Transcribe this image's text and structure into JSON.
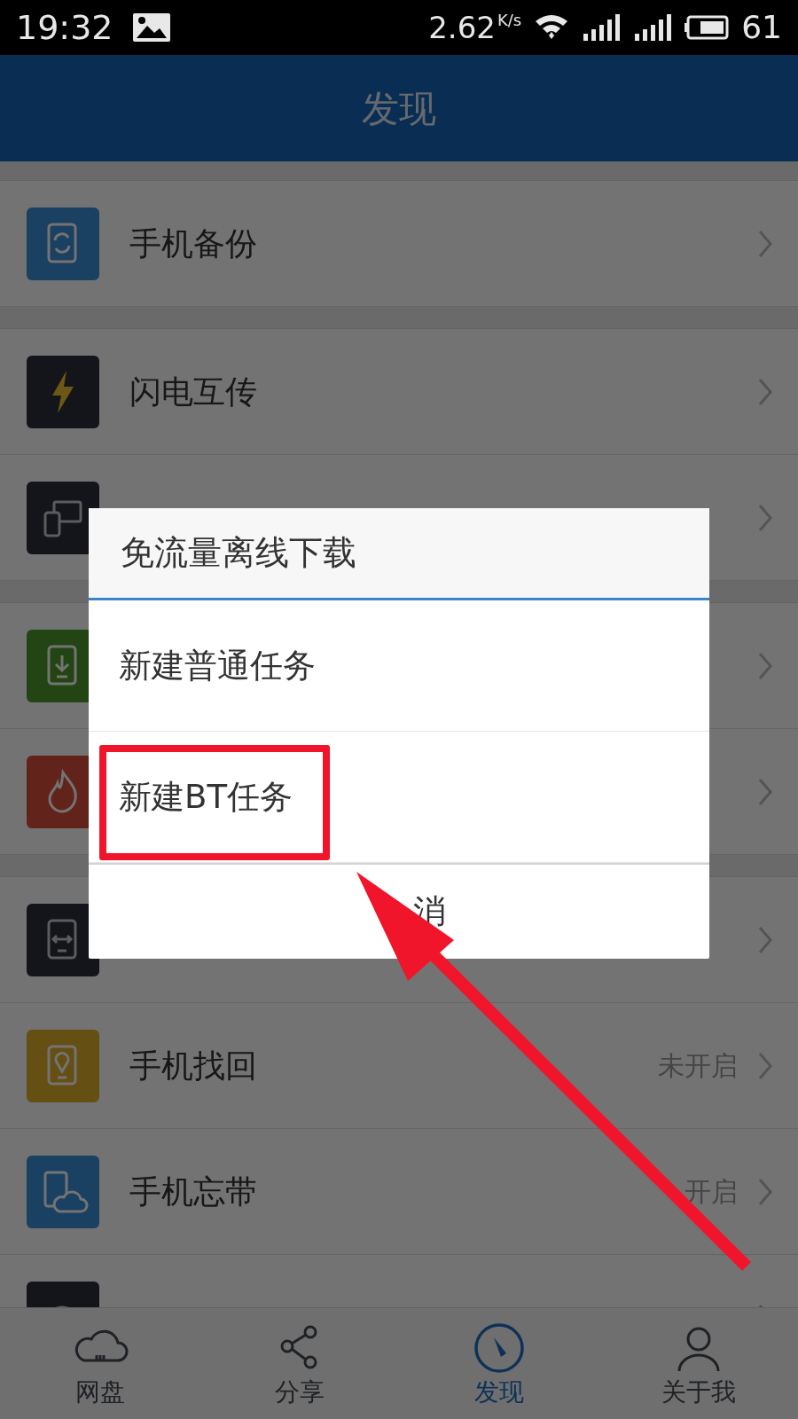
{
  "status_bar": {
    "time": "19:32",
    "speed": "2.62",
    "speed_unit": "K/s",
    "battery": "61"
  },
  "header": {
    "title": "发现"
  },
  "sections": [
    {
      "rows": [
        {
          "kind": "backup",
          "label": "手机备份"
        }
      ]
    },
    {
      "rows": [
        {
          "kind": "bolt",
          "label": "闪电互传"
        },
        {
          "kind": "devices"
        }
      ]
    },
    {
      "rows": [
        {
          "kind": "download"
        },
        {
          "kind": "fire"
        }
      ]
    },
    {
      "rows": [
        {
          "kind": "transfer"
        },
        {
          "kind": "location",
          "label": "手机找回",
          "status": "未开启"
        },
        {
          "kind": "cloudsync",
          "label": "手机忘带",
          "status": "开启"
        },
        {
          "kind": "media"
        }
      ]
    }
  ],
  "dialog": {
    "title": "免流量离线下载",
    "options": [
      {
        "label": "新建普通任务",
        "highlighted": false
      },
      {
        "label": "新建BT任务",
        "highlighted": true
      }
    ],
    "cancel": "消"
  },
  "tabs": [
    {
      "kind": "cloud",
      "label": "网盘",
      "selected": false
    },
    {
      "kind": "share",
      "label": "分享",
      "selected": false
    },
    {
      "kind": "compass",
      "label": "发现",
      "selected": true
    },
    {
      "kind": "person",
      "label": "关于我",
      "selected": false
    }
  ]
}
